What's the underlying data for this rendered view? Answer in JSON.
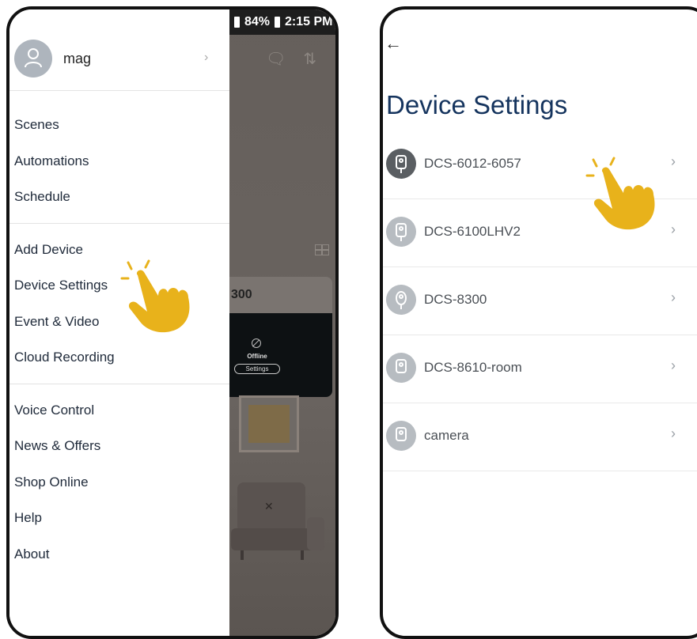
{
  "left_screen": {
    "status_bar": {
      "battery": "84%",
      "time": "2:15 PM"
    },
    "profile": {
      "name": "mag"
    },
    "menu_groups": [
      [
        "Scenes",
        "Automations",
        "Schedule"
      ],
      [
        "Add Device",
        "Device Settings",
        "Event & Video",
        "Cloud Recording"
      ],
      [
        "Voice Control",
        "News & Offers",
        "Shop Online",
        "Help",
        "About"
      ]
    ],
    "background_card": {
      "title": "300",
      "status": "Offline",
      "button": "Settings"
    }
  },
  "right_screen": {
    "title": "Device Settings",
    "devices": [
      {
        "name": "DCS-6012-6057",
        "selected": true
      },
      {
        "name": "DCS-6100LHV2",
        "selected": false
      },
      {
        "name": "DCS-8300",
        "selected": false
      },
      {
        "name": "DCS-8610-room",
        "selected": false
      },
      {
        "name": "camera",
        "selected": false
      }
    ]
  },
  "colors": {
    "title": "#15345e",
    "hand": "#e8b21b",
    "drawer_overlay": "#6b6561"
  },
  "icons": [
    "back-arrow-icon",
    "chevron-right-icon",
    "user-icon",
    "camera-icon",
    "hand-pointer-icon"
  ]
}
